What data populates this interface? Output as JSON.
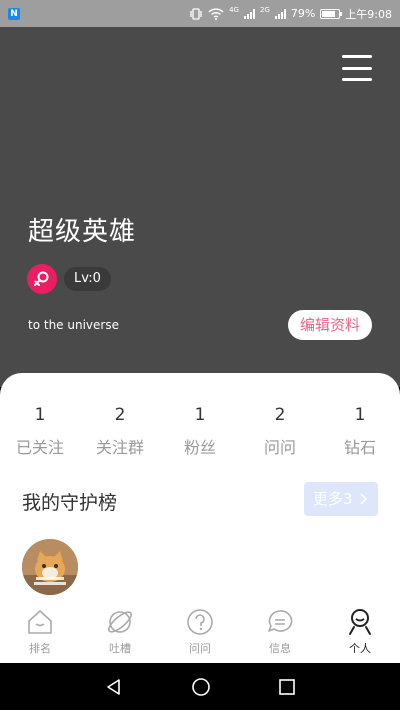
{
  "status_bar": {
    "app_icon": "n-app-icon",
    "network_labels": [
      "4G",
      "2G"
    ],
    "battery_percent": 79,
    "battery_text": "79%",
    "time": "上午9:08"
  },
  "header": {
    "menu_icon": "hamburger-menu-icon",
    "username": "超级英雄",
    "gender_icon": "female-icon",
    "level": "Lv:0",
    "signature": "to the universe",
    "edit_label": "编辑资料",
    "colors": {
      "background": "#4a4a4a",
      "accent": "#e91e63",
      "edit_text": "#e8668a"
    }
  },
  "stats": [
    {
      "count": "1",
      "label": "已关注"
    },
    {
      "count": "2",
      "label": "关注群"
    },
    {
      "count": "1",
      "label": "粉丝"
    },
    {
      "count": "2",
      "label": "问问"
    },
    {
      "count": "1",
      "label": "钻石"
    }
  ],
  "guard": {
    "title": "我的守护榜",
    "more_label": "更多3",
    "more_icon": "chevron-right-icon"
  },
  "tabs": [
    {
      "label": "排名",
      "icon": "house-icon",
      "active": false
    },
    {
      "label": "吐槽",
      "icon": "planet-icon",
      "active": false
    },
    {
      "label": "问问",
      "icon": "question-circle-icon",
      "active": false
    },
    {
      "label": "信息",
      "icon": "chat-bubble-icon",
      "active": false
    },
    {
      "label": "个人",
      "icon": "person-icon",
      "active": true
    }
  ],
  "nav": {
    "back_icon": "back-triangle-icon",
    "home_icon": "home-circle-icon",
    "recents_icon": "recents-square-icon"
  }
}
